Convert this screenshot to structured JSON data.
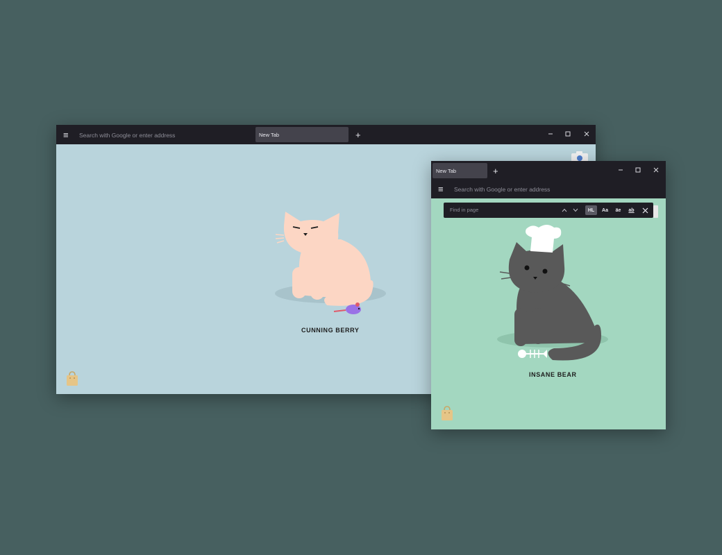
{
  "window_back": {
    "menu_icon": "hamburger-menu-icon",
    "address_placeholder": "Search with Google or enter address",
    "tab_title": "New Tab",
    "new_tab_glyph": "+",
    "cat_name": "CUNNING BERRY",
    "colors": {
      "background": "#b9d4dc",
      "cat": "#fcd6c4",
      "toy": "#9a72e6",
      "titlebar": "#1f1e25"
    }
  },
  "window_front": {
    "tab_title": "New Tab",
    "new_tab_glyph": "+",
    "address_placeholder": "Search with Google or enter address",
    "find": {
      "placeholder": "Find in page",
      "highlight_label": "HL",
      "match_case_label": "Aa",
      "diacritics_label": "äe",
      "whole_words_label": "ab"
    },
    "cat_name": "INSANE BEAR",
    "colors": {
      "background": "#a3d7c0",
      "cat": "#595959",
      "hat": "#ffffff",
      "titlebar": "#1f1e25"
    }
  }
}
